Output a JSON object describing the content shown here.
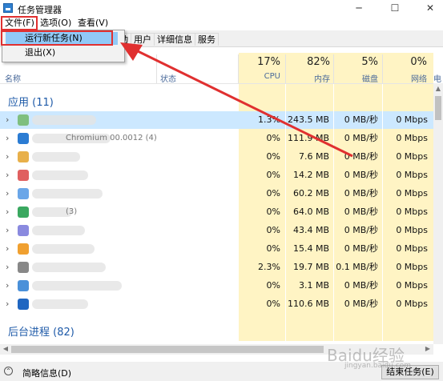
{
  "window": {
    "title": "任务管理器",
    "minimize": "─",
    "maximize": "☐",
    "close": "✕"
  },
  "menu": {
    "file": "文件(F)",
    "options": "选项(O)",
    "view": "查看(V)"
  },
  "file_menu": {
    "run_new_task": "运行新任务(N)",
    "exit": "退出(X)"
  },
  "tabs": [
    "启动",
    "用户",
    "详细信息",
    "服务"
  ],
  "columns": {
    "name": "名称",
    "status": "状态",
    "cpu": {
      "pct": "17%",
      "label": "CPU"
    },
    "memory": {
      "pct": "82%",
      "label": "内存"
    },
    "disk": {
      "pct": "5%",
      "label": "磁盘"
    },
    "network": {
      "pct": "0%",
      "label": "网络"
    },
    "power": "电"
  },
  "groups": {
    "apps": "应用 (11)",
    "background": "后台进程 (82)"
  },
  "rows": [
    {
      "cpu": "1.3%",
      "mem": "243.5 MB",
      "disk": "0 MB/秒",
      "net": "0 Mbps",
      "suffix": ""
    },
    {
      "cpu": "0%",
      "mem": "111.9 MB",
      "disk": "0 MB/秒",
      "net": "0 Mbps",
      "suffix": "Chromium 00.0012 (4)"
    },
    {
      "cpu": "0%",
      "mem": "7.6 MB",
      "disk": "0 MB/秒",
      "net": "0 Mbps",
      "suffix": ""
    },
    {
      "cpu": "0%",
      "mem": "14.2 MB",
      "disk": "0 MB/秒",
      "net": "0 Mbps",
      "suffix": ""
    },
    {
      "cpu": "0%",
      "mem": "60.2 MB",
      "disk": "0 MB/秒",
      "net": "0 Mbps",
      "suffix": ""
    },
    {
      "cpu": "0%",
      "mem": "64.0 MB",
      "disk": "0 MB/秒",
      "net": "0 Mbps",
      "suffix": "(3)"
    },
    {
      "cpu": "0%",
      "mem": "43.4 MB",
      "disk": "0 MB/秒",
      "net": "0 Mbps",
      "suffix": ""
    },
    {
      "cpu": "0%",
      "mem": "15.4 MB",
      "disk": "0 MB/秒",
      "net": "0 Mbps",
      "suffix": ""
    },
    {
      "cpu": "2.3%",
      "mem": "19.7 MB",
      "disk": "0.1 MB/秒",
      "net": "0 Mbps",
      "suffix": ""
    },
    {
      "cpu": "0%",
      "mem": "3.1 MB",
      "disk": "0 MB/秒",
      "net": "0 Mbps",
      "suffix": ""
    },
    {
      "cpu": "0%",
      "mem": "110.6 MB",
      "disk": "0 MB/秒",
      "net": "0 Mbps",
      "suffix": ""
    }
  ],
  "status_bar": {
    "fewer_details": "简略信息(D)",
    "end_task": "结束任务(E)"
  },
  "watermark": {
    "brand": "Baidu经验",
    "url": "jingyan.baidu.com"
  },
  "colors": {
    "highlight": "#91c9f7",
    "selected_row": "#cce8ff",
    "heat": "#fff4c4",
    "annotation": "#e03030",
    "group_title": "#1e5aa8"
  }
}
